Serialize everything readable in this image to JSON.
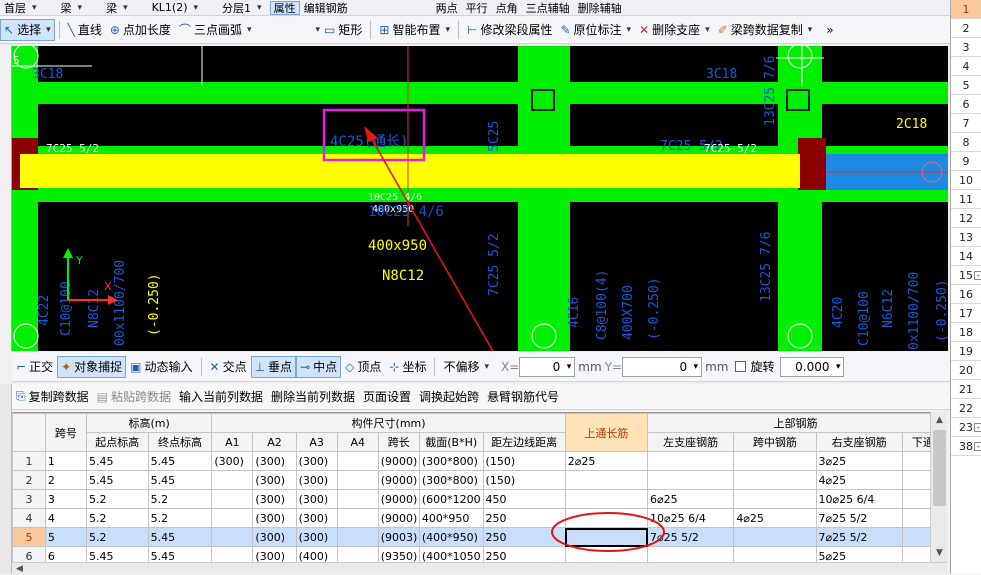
{
  "toolbar_top": {
    "items": [
      "首层",
      "梁",
      "梁",
      "KL1(2)",
      "分层1",
      "属性",
      "编辑钢筋",
      "两点",
      "平行",
      "点角",
      "三点辅轴",
      "删除辅轴"
    ]
  },
  "toolbar_draw": {
    "select": "选择",
    "line": "直线",
    "point_length": "点加长度",
    "arc": "三点画弧",
    "rect": "矩形",
    "smart_layout": "智能布置",
    "modify_span": "修改梁段属性",
    "in_situ": "原位标注",
    "delete_support": "删除支座",
    "copy_span_data": "梁跨数据复制",
    "more": "»"
  },
  "toolbar_snap": {
    "ortho": "正交",
    "obj_snap": "对象捕捉",
    "dyn_input": "动态输入",
    "intersect": "交点",
    "perp": "垂点",
    "mid": "中点",
    "vertex": "顶点",
    "coord": "坐标",
    "no_offset": "不偏移",
    "x_label": "X=",
    "x_val": "0",
    "unit1": "mm",
    "y_label": "Y=",
    "y_val": "0",
    "unit2": "mm",
    "rotate": "旋转",
    "rotate_val": "0.000"
  },
  "toolbar_grid": {
    "copy_span": "复制跨数据",
    "paste_span": "粘贴跨数据",
    "input_col": "输入当前列数据",
    "delete_col": "删除当前列数据",
    "page_setup": "页面设置",
    "swap_start": "调换起始跨",
    "cantilever": "悬臂钢筋代号"
  },
  "canvas_labels": {
    "t1": "3C18",
    "t2": "3C18",
    "t3": "13C25 7/6",
    "t4": "2C18",
    "t5": "7C25 5/2",
    "t6": "4C25(通长)",
    "t7": "5C25",
    "t8": "7C25 5/2",
    "t9": "7C25 5/2",
    "t10": "10C25 4/6",
    "t11": "400x950",
    "t12": "10C25 4/6",
    "t13": "400x950",
    "t14": "N8C12",
    "t15": "7C25 5/2",
    "t16": "13C25 7/6",
    "t17": "4C22",
    "t18": "C10@100",
    "t19": "N8C12",
    "t20": "00x1100/700",
    "t21": "(-0.250)",
    "t22": "4C16",
    "t23": "C8@100(4)",
    "t24": "400X700",
    "t25": "(-0.250)",
    "t26": "4C20",
    "t27": "C10@100",
    "t28": "N6C12",
    "t29": "0x1100/700",
    "t30": "(-0.250)",
    "axis_y": "Y",
    "axis_x": "X",
    "axis_n": "5"
  },
  "grid": {
    "group_headers": {
      "span_no": "跨号",
      "elevation": "标高(m)",
      "dims": "构件尺寸(mm)",
      "top_through": "上通长筋",
      "top_rebar": "上部钢筋"
    },
    "sub_headers": {
      "start_elev": "起点标高",
      "end_elev": "终点标高",
      "a1": "A1",
      "a2": "A2",
      "a3": "A3",
      "a4": "A4",
      "span_len": "跨长",
      "section": "截面(B*H)",
      "edge_dist": "距左边线距离",
      "left_support": "左支座钢筋",
      "mid_span": "跨中钢筋",
      "right_support": "右支座钢筋",
      "lower_through": "下通"
    },
    "rows": [
      {
        "rn": "1",
        "span": "1",
        "s": "5.45",
        "e": "5.45",
        "a1": "(300)",
        "a2": "(300)",
        "a3": "(300)",
        "a4": "",
        "len": "(9000)",
        "sec": "(300*800)",
        "dist": "(150)",
        "through": "2⌀25",
        "ls": "",
        "mid": "",
        "rs": "3⌀25"
      },
      {
        "rn": "2",
        "span": "2",
        "s": "5.45",
        "e": "5.45",
        "a1": "",
        "a2": "(300)",
        "a3": "(300)",
        "a4": "",
        "len": "(9000)",
        "sec": "(300*800)",
        "dist": "(150)",
        "through": "",
        "ls": "",
        "mid": "",
        "rs": "4⌀25"
      },
      {
        "rn": "3",
        "span": "3",
        "s": "5.2",
        "e": "5.2",
        "a1": "",
        "a2": "(300)",
        "a3": "(300)",
        "a4": "",
        "len": "(9000)",
        "sec": "(600*1200",
        "dist": "450",
        "through": "",
        "ls": "6⌀25",
        "mid": "",
        "rs": "10⌀25 6/4"
      },
      {
        "rn": "4",
        "span": "4",
        "s": "5.2",
        "e": "5.2",
        "a1": "",
        "a2": "(300)",
        "a3": "(300)",
        "a4": "",
        "len": "(9000)",
        "sec": "400*950",
        "dist": "250",
        "through": "",
        "ls": "10⌀25 6/4",
        "mid": "4⌀25",
        "rs": "7⌀25 5/2"
      },
      {
        "rn": "5",
        "span": "5",
        "s": "5.2",
        "e": "5.45",
        "a1": "",
        "a2": "(300)",
        "a3": "(300)",
        "a4": "",
        "len": "(9003)",
        "sec": "(400*950)",
        "dist": "250",
        "through": "",
        "ls": "7⌀25 5/2",
        "mid": "",
        "rs": "7⌀25 5/2"
      },
      {
        "rn": "6",
        "span": "6",
        "s": "5.45",
        "e": "5.45",
        "a1": "",
        "a2": "(300)",
        "a3": "(400)",
        "a4": "",
        "len": "(9350)",
        "sec": "(400*1050",
        "dist": "250",
        "through": "",
        "ls": "",
        "mid": "",
        "rs": "5⌀25"
      }
    ],
    "selected_row": "5"
  },
  "right_panel": {
    "rows": [
      "1",
      "2",
      "3",
      "4",
      "5",
      "6",
      "7",
      "8",
      "9",
      "10",
      "11",
      "12",
      "13",
      "14",
      "15",
      "16",
      "17",
      "18",
      "19",
      "20",
      "21",
      "22",
      "23",
      "38"
    ],
    "selected": "1"
  },
  "colors": {
    "beam_green": "#00ee00",
    "beam_yellow": "#ffff00",
    "rebar_text_blue": "#1a5ad8",
    "highlight_box": "#e020e0",
    "annotation_red": "#e01818"
  }
}
